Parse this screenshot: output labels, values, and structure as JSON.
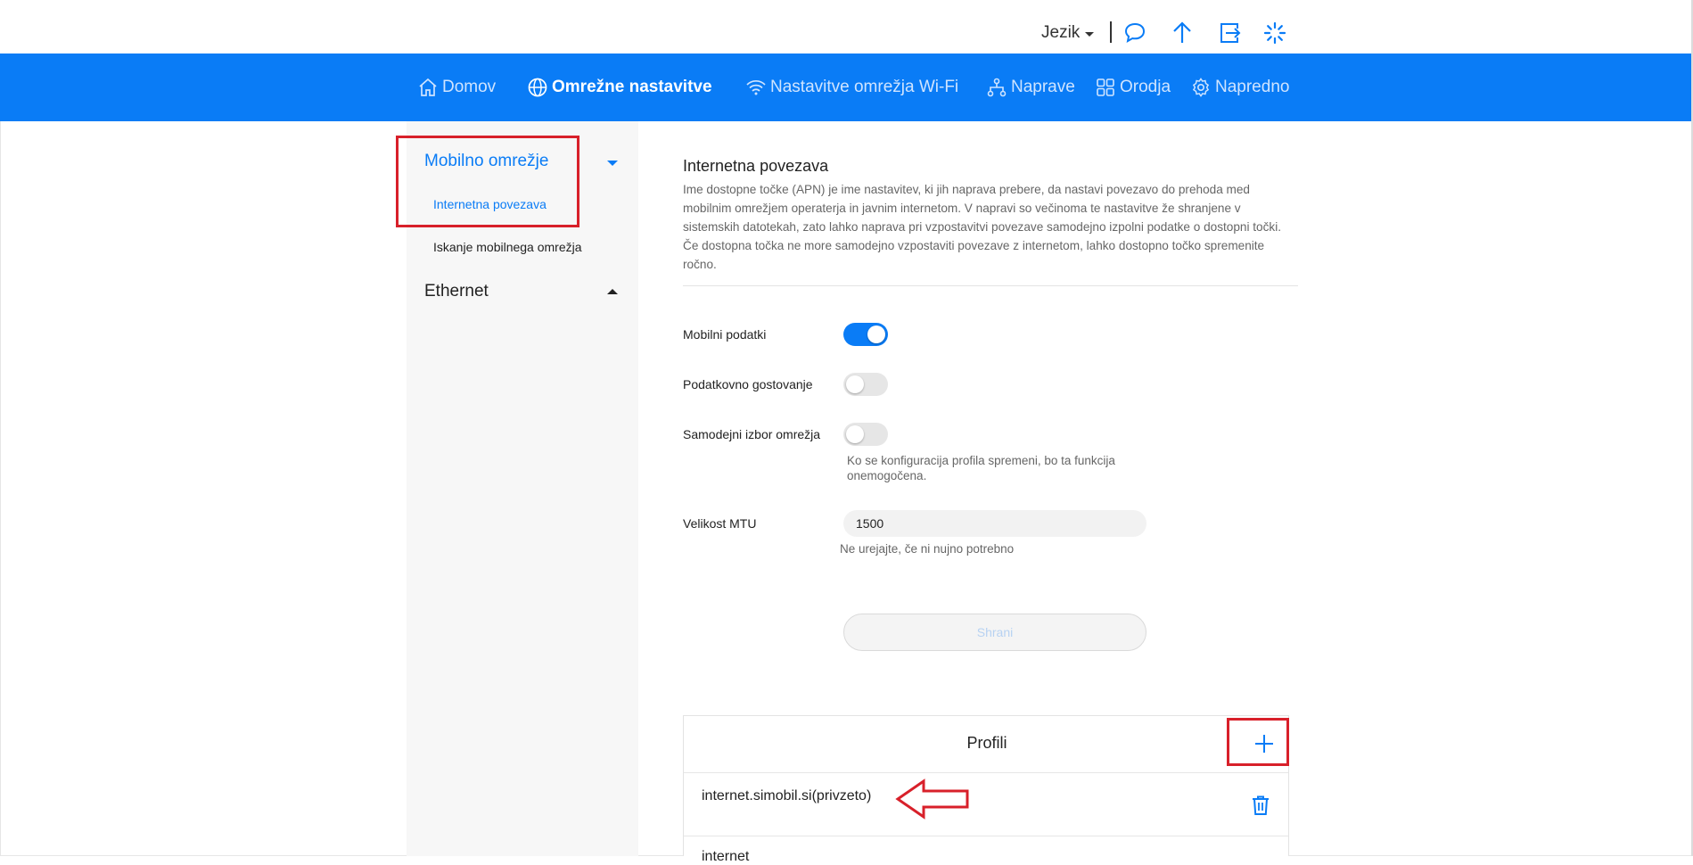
{
  "header": {
    "language_label": "Jezik",
    "icons": [
      "chat-icon",
      "upload-icon",
      "logout-icon",
      "loading-icon"
    ]
  },
  "nav": {
    "items": [
      {
        "label": "Domov",
        "icon": "home-icon"
      },
      {
        "label": "Omrežne nastavitve",
        "icon": "globe-icon",
        "active": true
      },
      {
        "label": "Nastavitve omrežja Wi-Fi",
        "icon": "wifi-icon"
      },
      {
        "label": "Naprave",
        "icon": "devices-icon"
      },
      {
        "label": "Orodja",
        "icon": "tools-icon"
      },
      {
        "label": "Napredno",
        "icon": "gear-icon"
      }
    ]
  },
  "sidebar": {
    "groups": [
      {
        "label": "Mobilno omrežje",
        "expanded": true,
        "items": [
          {
            "label": "Internetna povezava",
            "active": true
          },
          {
            "label": "Iskanje mobilnega omrežja"
          }
        ]
      },
      {
        "label": "Ethernet",
        "expanded": false
      }
    ]
  },
  "main": {
    "title": "Internetna povezava",
    "description": "Ime dostopne točke (APN) je ime nastavitev, ki jih naprava prebere, da nastavi povezavo do prehoda med mobilnim omrežjem operaterja in javnim internetom. V napravi so večinoma te nastavitve že shranjene v sistemskih datotekah, zato lahko naprava pri vzpostavitvi povezave samodejno izpolni podatke o dostopni točki. Če dostopna točka ne more samodejno vzpostaviti povezave z internetom, lahko dostopno točko spremenite ročno.",
    "settings": {
      "mobile_data": {
        "label": "Mobilni podatki",
        "on": true
      },
      "roaming": {
        "label": "Podatkovno gostovanje",
        "on": false
      },
      "auto_network": {
        "label": "Samodejni izbor omrežja",
        "on": false,
        "hint": "Ko se konfiguracija profila spremeni, bo ta funkcija onemogočena."
      },
      "mtu": {
        "label": "Velikost MTU",
        "value": "1500",
        "hint": "Ne urejajte, če ni nujno potrebno"
      }
    },
    "save_label": "Shrani",
    "profiles": {
      "title": "Profili",
      "items": [
        "internet.simobil.si(privzeto)",
        "internet"
      ]
    }
  },
  "colors": {
    "accent": "#0a7cf6",
    "annotation_red": "#d8202a"
  }
}
